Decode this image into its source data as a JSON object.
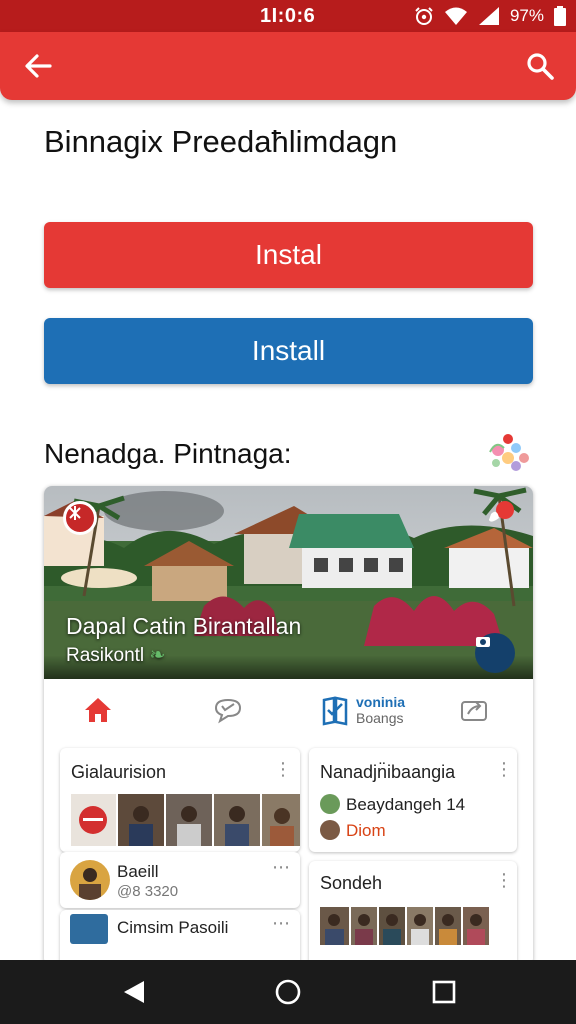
{
  "status_bar": {
    "time": "1Ɩ:0:6",
    "battery": "97%",
    "icons": [
      "alarm-icon",
      "wifi-icon",
      "signal-icon",
      "battery-icon"
    ]
  },
  "app_bar": {
    "back_icon": "back-arrow-icon",
    "search_icon": "search-icon",
    "color": "#e53935"
  },
  "page": {
    "title": "Binnagix Preedaħlimdagn"
  },
  "buttons": {
    "primary_label": "Instal",
    "secondary_label": "Install",
    "primary_color": "#e53935",
    "secondary_color": "#1e6fb5"
  },
  "section": {
    "title": "Nenadga. Pintnaga:",
    "icon": "flower-icon"
  },
  "featured": {
    "title": "Dapal Catin Birantallan",
    "subtitle": "Rasikontl",
    "subtitle_icon": "leaf-icon"
  },
  "tabs": {
    "active_label": "voninia",
    "active_sub": "Boangs",
    "items": [
      "home-icon",
      "chat-icon",
      "book-icon",
      "share-icon"
    ]
  },
  "cards": {
    "left_top": {
      "title": "Gialaurision"
    },
    "left_row1": {
      "title": "Baeill",
      "sub": "@8 3320"
    },
    "left_row2": {
      "title": "Cimsim Pasoili"
    },
    "right_top": {
      "title": "Nanadjn̈ibaangia",
      "row1": "Beaydangeh 14",
      "row2": "Diom"
    },
    "right_bottom": {
      "title": "Sondeh"
    }
  },
  "nav": {
    "items": [
      "back-triangle-icon",
      "home-circle-icon",
      "recents-square-icon"
    ]
  }
}
